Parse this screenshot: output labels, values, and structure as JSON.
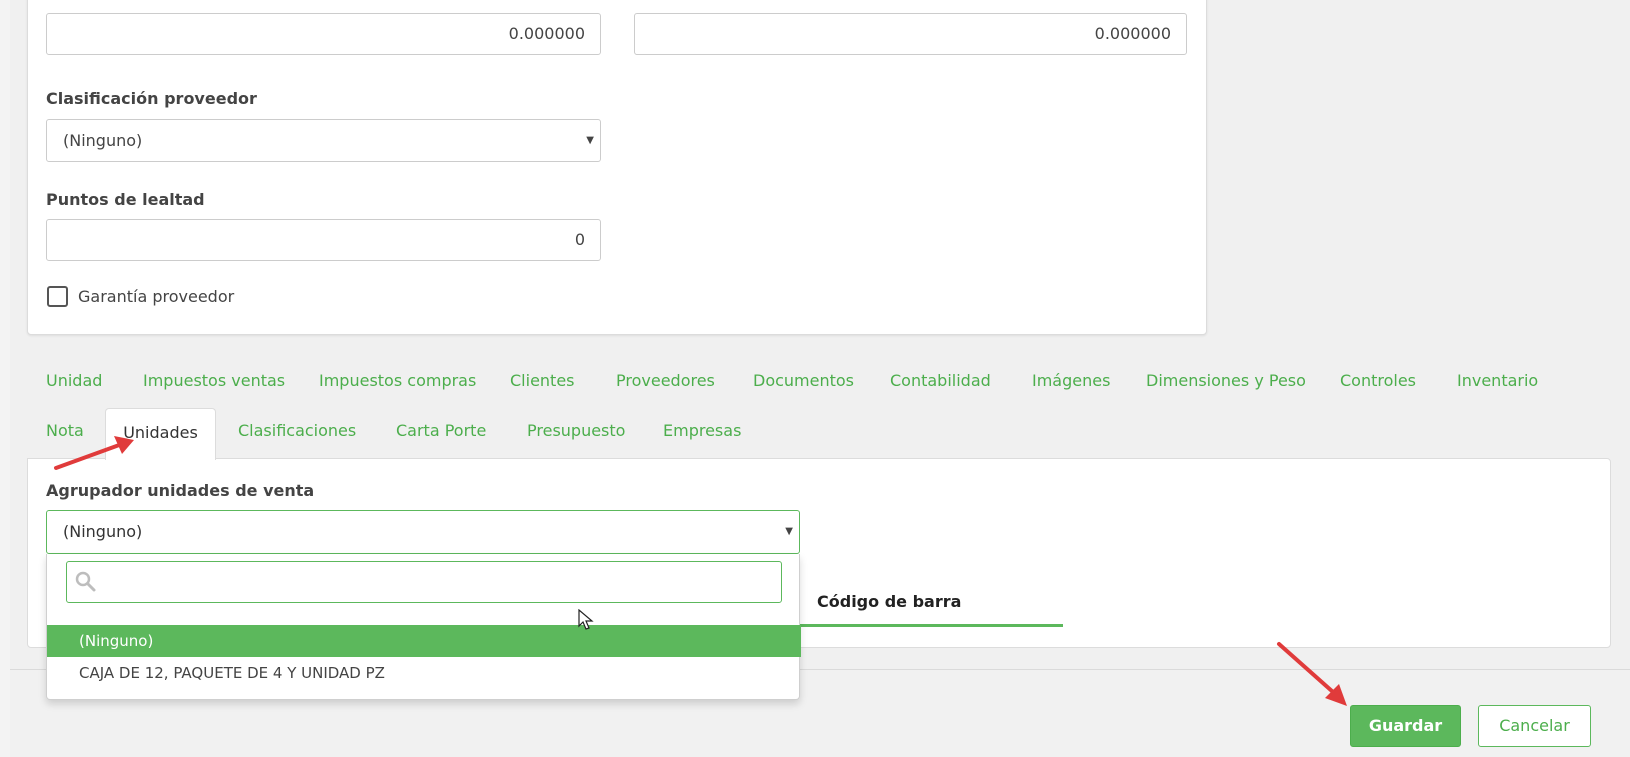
{
  "top_form": {
    "input1_value": "0.000000",
    "input2_value": "0.000000",
    "supplier_classification_label": "Clasificación proveedor",
    "supplier_classification_value": "(Ninguno)",
    "loyalty_points_label": "Puntos de lealtad",
    "loyalty_points_value": "0",
    "supplier_warranty_label": "Garantía proveedor"
  },
  "tabs": [
    {
      "label": "Unidad"
    },
    {
      "label": "Impuestos ventas"
    },
    {
      "label": "Impuestos compras"
    },
    {
      "label": "Clientes"
    },
    {
      "label": "Proveedores"
    },
    {
      "label": "Documentos"
    },
    {
      "label": "Contabilidad"
    },
    {
      "label": "Imágenes"
    },
    {
      "label": "Dimensiones y Peso"
    },
    {
      "label": "Controles"
    },
    {
      "label": "Inventario"
    },
    {
      "label": "Nota"
    },
    {
      "label": "Unidades"
    },
    {
      "label": "Clasificaciones"
    },
    {
      "label": "Carta Porte"
    },
    {
      "label": "Presupuesto"
    },
    {
      "label": "Empresas"
    }
  ],
  "active_tab": "Unidades",
  "units_panel": {
    "sales_group_label": "Agrupador unidades de venta",
    "sales_group_value": "(Ninguno)",
    "barcode_column": "Código de barra"
  },
  "dropdown": {
    "search_value": "",
    "options": [
      {
        "label": "(Ninguno)"
      },
      {
        "label": "CAJA DE 12, PAQUETE DE 4 Y UNIDAD PZ"
      }
    ]
  },
  "footer": {
    "save_label": "Guardar",
    "cancel_label": "Cancelar"
  },
  "colors": {
    "accent": "#5cb85c",
    "annotation_arrow": "#e03b3b"
  }
}
